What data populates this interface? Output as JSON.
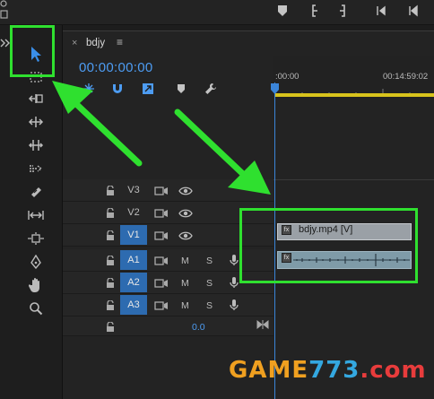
{
  "sequence": {
    "name": "bdjy",
    "timecode": "00:00:00:00"
  },
  "ruler": {
    "start_label": ":00:00",
    "end_label": "00:14:59:02"
  },
  "tracks": {
    "video": [
      {
        "label": "V3",
        "active": false
      },
      {
        "label": "V2",
        "active": false
      },
      {
        "label": "V1",
        "active": true
      }
    ],
    "audio": [
      {
        "label": "A1",
        "active": true,
        "mute": "M",
        "solo": "S"
      },
      {
        "label": "A2",
        "active": true,
        "mute": "M",
        "solo": "S"
      },
      {
        "label": "A3",
        "active": true,
        "mute": "M",
        "solo": "S"
      }
    ],
    "master_volume": "0.0"
  },
  "clips": {
    "video_clip_name": "bdjy.mp4 [V]",
    "fx_badge": "fx"
  },
  "watermark": {
    "part1": "GAME",
    "part2": "773",
    "part3": ".com"
  },
  "icons": {
    "selection_tool": "arrow-pointer-icon",
    "playhead_color": "#3b85d9",
    "highlight_color": "#2fe02f",
    "annotation_arrow_color": "#2fe02f",
    "timecode_color": "#4d9cf2"
  }
}
